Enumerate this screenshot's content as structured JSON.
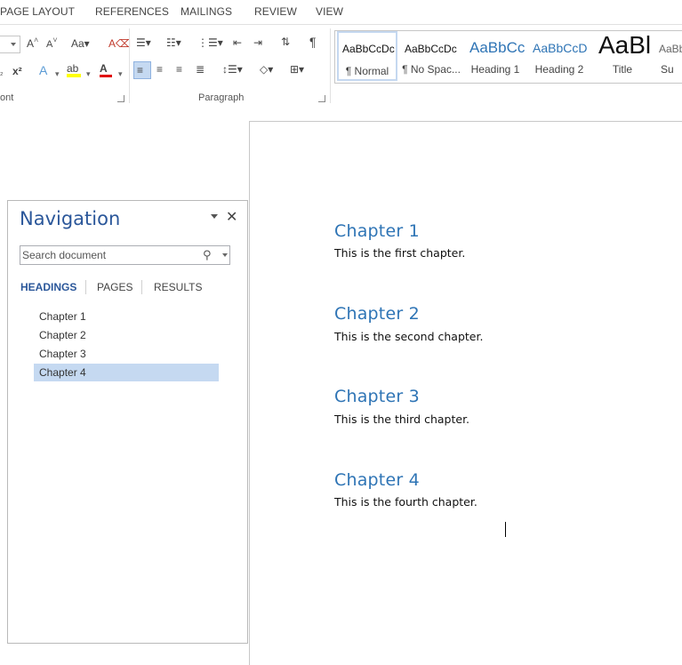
{
  "ribbon_tabs": [
    "PAGE LAYOUT",
    "REFERENCES",
    "MAILINGS",
    "REVIEW",
    "VIEW"
  ],
  "groups": {
    "font_label": "ont",
    "paragraph_label": "Paragraph"
  },
  "styles": [
    {
      "preview": "AaBbCcDc",
      "name": "¶ Normal"
    },
    {
      "preview": "AaBbCcDc",
      "name": "¶ No Spac..."
    },
    {
      "preview": "AaBbCc",
      "name": "Heading 1"
    },
    {
      "preview": "AaBbCcD",
      "name": "Heading 2"
    },
    {
      "preview": "AaBl",
      "name": "Title"
    },
    {
      "preview": "AaBb",
      "name": "Su"
    }
  ],
  "navigation": {
    "title": "Navigation",
    "search_placeholder": "Search document",
    "tabs": [
      "HEADINGS",
      "PAGES",
      "RESULTS"
    ],
    "headings": [
      "Chapter 1",
      "Chapter 2",
      "Chapter 3",
      "Chapter 4"
    ]
  },
  "document": {
    "sections": [
      {
        "heading": "Chapter 1",
        "text": "This is the first chapter."
      },
      {
        "heading": "Chapter 2",
        "text": "This is the second chapter."
      },
      {
        "heading": "Chapter 3",
        "text": "This is the third chapter."
      },
      {
        "heading": "Chapter 4",
        "text": "This is the fourth chapter."
      }
    ]
  },
  "colors": {
    "heading_blue": "#2e74b5",
    "nav_title": "#2b579a",
    "selection": "#c5d9f1"
  }
}
